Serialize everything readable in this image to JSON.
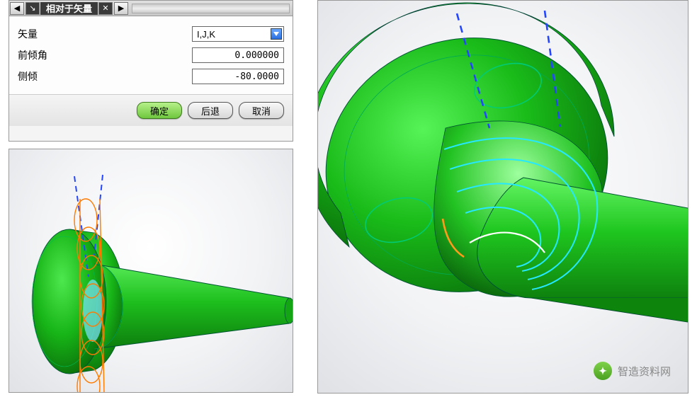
{
  "dialog": {
    "title": "相对于矢量",
    "rows": {
      "vector": {
        "label": "矢量",
        "value": "I,J,K"
      },
      "lead": {
        "label": "前倾角",
        "value": "0.000000"
      },
      "tilt": {
        "label": "侧倾",
        "value": "-80.0000"
      }
    },
    "buttons": {
      "ok": "确定",
      "back": "后退",
      "cancel": "取消"
    }
  },
  "watermark": {
    "text": "智造资料网"
  }
}
